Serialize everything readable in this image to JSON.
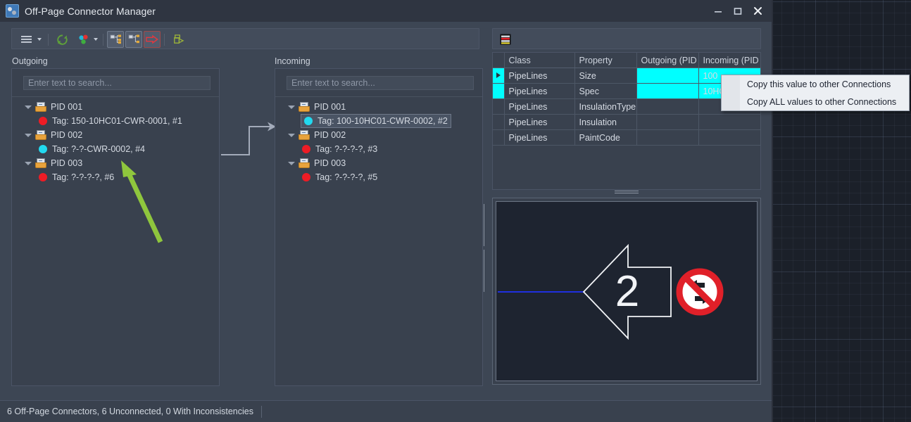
{
  "window": {
    "title": "Off-Page Connector Manager",
    "icon": "app-connector-icon",
    "minimize": "minimize-icon",
    "maximize": "maximize-icon",
    "close": "close-icon"
  },
  "toolbar": {
    "menu_button": "hamburger-menu-icon",
    "menu_caret": "chevron-down-icon",
    "refresh_button": "refresh-icon",
    "colors_button": "color-dots-icon",
    "colors_caret": "chevron-down-icon",
    "tree_expand_button": "tree-branches-icon",
    "tree_collapse_button": "tree-single-branch-icon",
    "arrow_button": "red-arrow-icon",
    "export_button": "export-connector-icon",
    "grid_settings_button": "color-legend-icon"
  },
  "columns": {
    "outgoing_label": "Outgoing",
    "incoming_label": "Incoming"
  },
  "search": {
    "placeholder": "Enter text to search..."
  },
  "outgoing_tree": [
    {
      "type": "pid",
      "label": "PID 001",
      "expanded": true
    },
    {
      "type": "tag",
      "label": "Tag: 150-10HC01-CWR-0001, #1",
      "status": "red",
      "selected": false
    },
    {
      "type": "pid",
      "label": "PID 002",
      "expanded": true
    },
    {
      "type": "tag",
      "label": "Tag: ?-?-CWR-0002, #4",
      "status": "cyan",
      "selected": false
    },
    {
      "type": "pid",
      "label": "PID 003",
      "expanded": true
    },
    {
      "type": "tag",
      "label": "Tag: ?-?-?-?, #6",
      "status": "red",
      "selected": false
    }
  ],
  "incoming_tree": [
    {
      "type": "pid",
      "label": "PID 001",
      "expanded": true
    },
    {
      "type": "tag",
      "label": "Tag: 100-10HC01-CWR-0002, #2",
      "status": "cyan",
      "selected": true
    },
    {
      "type": "pid",
      "label": "PID 002",
      "expanded": true
    },
    {
      "type": "tag",
      "label": "Tag: ?-?-?-?, #3",
      "status": "red",
      "selected": false
    },
    {
      "type": "pid",
      "label": "PID 003",
      "expanded": true
    },
    {
      "type": "tag",
      "label": "Tag: ?-?-?-?, #5",
      "status": "red",
      "selected": false
    }
  ],
  "grid": {
    "headers": [
      "",
      "Class",
      "Property",
      "Outgoing (PID ...",
      "Incoming (PID ..."
    ],
    "rows": [
      {
        "marker": "current",
        "class": "PipeLines",
        "property": "Size",
        "outgoing": "",
        "incoming": "100",
        "outgoing_hl": true,
        "incoming_hl": true
      },
      {
        "marker": "selected",
        "class": "PipeLines",
        "property": "Spec",
        "outgoing": "",
        "incoming": "10HC0",
        "outgoing_hl": true,
        "incoming_hl": true
      },
      {
        "marker": "",
        "class": "PipeLines",
        "property": "InsulationType",
        "outgoing": "",
        "incoming": "",
        "outgoing_hl": false,
        "incoming_hl": false
      },
      {
        "marker": "",
        "class": "PipeLines",
        "property": "Insulation",
        "outgoing": "",
        "incoming": "",
        "outgoing_hl": false,
        "incoming_hl": false
      },
      {
        "marker": "",
        "class": "PipeLines",
        "property": "PaintCode",
        "outgoing": "",
        "incoming": "",
        "outgoing_hl": false,
        "incoming_hl": false
      }
    ]
  },
  "context_menu": {
    "items": [
      "Copy this value to other Connections",
      "Copy ALL values to other Connections"
    ]
  },
  "preview": {
    "connector_number": "2",
    "prohibition_icon": "no-exchange-icon",
    "pipe_line_color": "#1f2fe0",
    "arrow_outline_color": "#f2f4f7"
  },
  "statusbar": {
    "text": "6 Off-Page Connectors, 6 Unconnected, 0 With Inconsistencies"
  },
  "annotation": {
    "arrow_color": "#8fc63d",
    "arrow_name": "green-annotation-arrow"
  },
  "colors": {
    "highlight_cyan": "#00ffff",
    "status_red": "#ee1c25",
    "status_cyan": "#22d9ef",
    "window_bg": "#3d4654",
    "panel_bg": "#39414e"
  }
}
